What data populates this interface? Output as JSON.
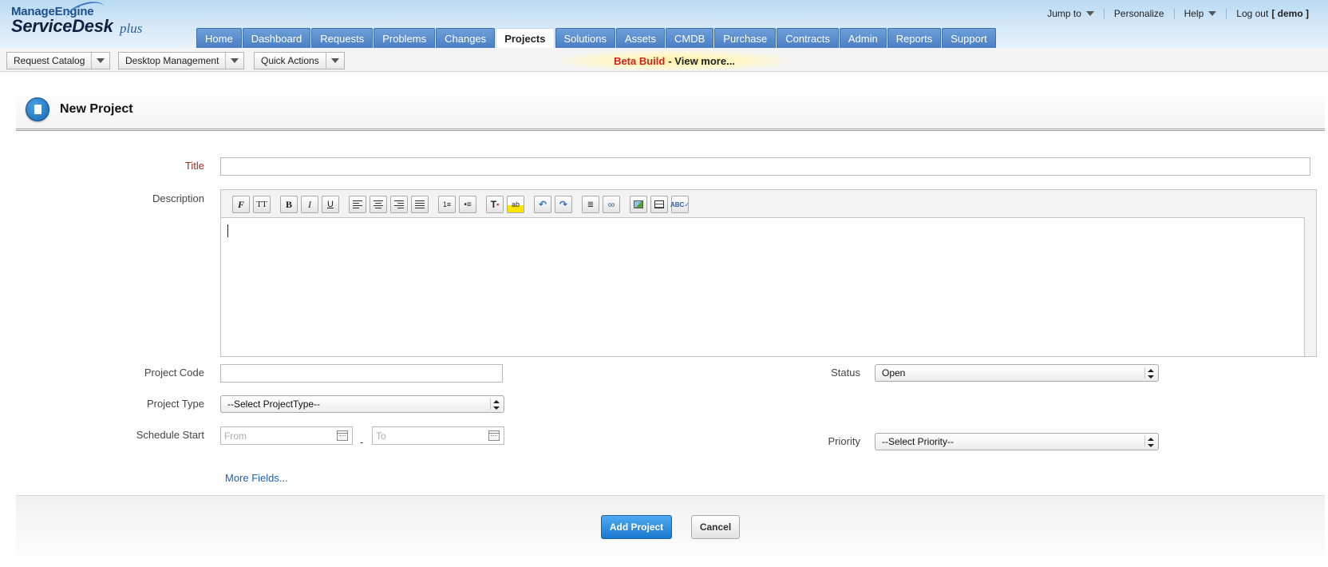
{
  "app": {
    "brand_top": "ManageEngine",
    "brand_main": "ServiceDesk",
    "brand_plus": "plus"
  },
  "top_links": {
    "jump_to": "Jump to",
    "personalize": "Personalize",
    "help": "Help",
    "logout": "Log out",
    "user": "[ demo ]"
  },
  "tabs": [
    {
      "label": "Home"
    },
    {
      "label": "Dashboard"
    },
    {
      "label": "Requests"
    },
    {
      "label": "Problems"
    },
    {
      "label": "Changes"
    },
    {
      "label": "Projects",
      "active": true
    },
    {
      "label": "Solutions"
    },
    {
      "label": "Assets"
    },
    {
      "label": "CMDB"
    },
    {
      "label": "Purchase"
    },
    {
      "label": "Contracts"
    },
    {
      "label": "Admin"
    },
    {
      "label": "Reports"
    },
    {
      "label": "Support"
    }
  ],
  "subbar": {
    "request_catalog": "Request Catalog",
    "desktop_management": "Desktop Management",
    "quick_actions": "Quick Actions",
    "beta_label": "Beta Build",
    "beta_link": "- View more..."
  },
  "page": {
    "title": "New Project"
  },
  "form": {
    "title_label": "Title",
    "title_value": "",
    "description_label": "Description",
    "project_code_label": "Project Code",
    "project_code_value": "",
    "status_label": "Status",
    "status_value": "Open",
    "project_type_label": "Project Type",
    "project_type_value": "--Select ProjectType--",
    "schedule_start_label": "Schedule Start",
    "from_placeholder": "From",
    "to_placeholder": "To",
    "range_separator": "-",
    "priority_label": "Priority",
    "priority_value": "--Select Priority--",
    "more_fields": "More Fields..."
  },
  "editor_toolbar": {
    "bold": "B",
    "italic": "I",
    "underline": "U"
  },
  "actions": {
    "add_project": "Add Project",
    "cancel": "Cancel"
  },
  "colors": {
    "tab_blue": "#4a7fc4",
    "required_label": "#9a2a1a",
    "primary_button": "#1a78cf",
    "beta_red": "#d62020",
    "link_blue": "#1f5fb3"
  }
}
